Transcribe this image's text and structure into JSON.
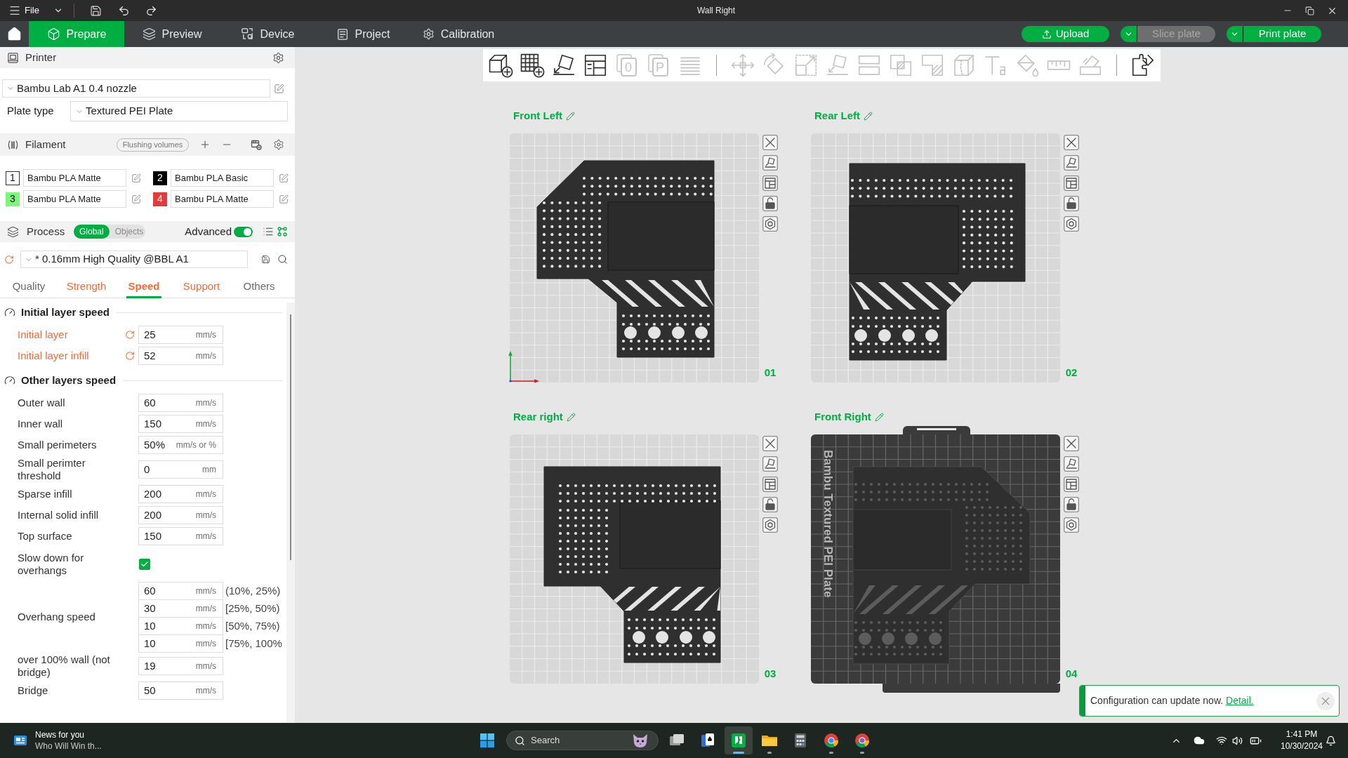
{
  "window": {
    "menu": "File",
    "title": "Wall Right"
  },
  "tabs": [
    {
      "label": "Prepare",
      "selected": true
    },
    {
      "label": "Preview",
      "selected": false
    },
    {
      "label": "Device",
      "selected": false
    },
    {
      "label": "Project",
      "selected": false
    },
    {
      "label": "Calibration",
      "selected": false
    }
  ],
  "actions": [
    {
      "kind": "upload",
      "label": "Upload",
      "disabled": false
    },
    {
      "kind": "split",
      "label": "Slice plate",
      "disabled": true
    },
    {
      "kind": "split",
      "label": "Print plate",
      "disabled": false
    }
  ],
  "printer": {
    "title": "Printer",
    "preset": "Bambu Lab A1 0.4 nozzle",
    "plate_type_label": "Plate type",
    "plate_type": "Textured PEI Plate"
  },
  "filament": {
    "title": "Filament",
    "flushing": "Flushing volumes",
    "slots": [
      {
        "number": "1",
        "name": "Bambu PLA Matte",
        "color": "#ffffff"
      },
      {
        "number": "2",
        "name": "Bambu PLA Basic",
        "color": "#000000"
      },
      {
        "number": "3",
        "name": "Bambu PLA Matte",
        "color": "#7ef57e"
      },
      {
        "number": "4",
        "name": "Bambu PLA Matte",
        "color": "#e03c3c"
      }
    ]
  },
  "process": {
    "title": "Process",
    "scope": [
      {
        "label": "Global",
        "selected": true
      },
      {
        "label": "Objects",
        "selected": false
      }
    ],
    "advanced": {
      "label": "Advanced",
      "on": true
    },
    "preset": "* 0.16mm High Quality @BBL A1",
    "tabs": [
      {
        "label": "Quality",
        "selected": false,
        "modified": false
      },
      {
        "label": "Strength",
        "selected": false,
        "modified": true
      },
      {
        "label": "Speed",
        "selected": true,
        "modified": true
      },
      {
        "label": "Support",
        "selected": false,
        "modified": true
      },
      {
        "label": "Others",
        "selected": false,
        "modified": false
      }
    ],
    "sections": [
      {
        "title": "Initial layer speed",
        "rows": [
          {
            "kind": "field",
            "label": "Initial layer",
            "modified": true,
            "value": "25",
            "unit": "mm/s"
          },
          {
            "kind": "field",
            "label": "Initial layer infill",
            "modified": true,
            "value": "52",
            "unit": "mm/s"
          }
        ]
      },
      {
        "title": "Other layers speed",
        "rows": [
          {
            "kind": "field",
            "label": "Outer wall",
            "modified": false,
            "value": "60",
            "unit": "mm/s"
          },
          {
            "kind": "field",
            "label": "Inner wall",
            "modified": false,
            "value": "150",
            "unit": "mm/s"
          },
          {
            "kind": "field",
            "label": "Small perimeters",
            "modified": false,
            "value": "50%",
            "unit": "mm/s or %"
          },
          {
            "kind": "field",
            "label": "Small perimter threshold",
            "modified": false,
            "value": "0",
            "unit": "mm"
          },
          {
            "kind": "field",
            "label": "Sparse infill",
            "modified": false,
            "value": "200",
            "unit": "mm/s"
          },
          {
            "kind": "field",
            "label": "Internal solid infill",
            "modified": false,
            "value": "200",
            "unit": "mm/s"
          },
          {
            "kind": "field",
            "label": "Top surface",
            "modified": false,
            "value": "150",
            "unit": "mm/s"
          },
          {
            "kind": "checkbox",
            "label": "Slow down for overhangs",
            "modified": false,
            "checked": true
          },
          {
            "kind": "multi",
            "label": "Overhang speed",
            "modified": false,
            "fields": [
              {
                "value": "60",
                "unit": "mm/s",
                "range": "(10%, 25%)"
              },
              {
                "value": "30",
                "unit": "mm/s",
                "range": "[25%, 50%)"
              },
              {
                "value": "10",
                "unit": "mm/s",
                "range": "[50%, 75%)"
              },
              {
                "value": "10",
                "unit": "mm/s",
                "range": "[75%, 100%"
              }
            ]
          },
          {
            "kind": "field",
            "label": "over 100% wall (not bridge)",
            "modified": false,
            "value": "19",
            "unit": "mm/s"
          },
          {
            "kind": "field",
            "label": "Bridge",
            "modified": false,
            "value": "50",
            "unit": "mm/s"
          }
        ]
      }
    ]
  },
  "toolbar": [
    [
      {
        "kind": "addpart",
        "disabled": false
      },
      {
        "kind": "addplate",
        "disabled": false
      },
      {
        "kind": "orient",
        "disabled": false
      },
      {
        "kind": "arrange",
        "disabled": false
      },
      {
        "kind": "number",
        "glyph": "0",
        "disabled": true
      },
      {
        "kind": "letter",
        "glyph": "P",
        "disabled": true
      },
      {
        "kind": "layers",
        "disabled": true
      }
    ],
    [
      {
        "kind": "move",
        "disabled": true
      },
      {
        "kind": "rotate",
        "disabled": true
      },
      {
        "kind": "scale",
        "disabled": true
      },
      {
        "kind": "layflat",
        "disabled": true
      },
      {
        "kind": "cut",
        "disabled": true
      },
      {
        "kind": "boolean",
        "disabled": true
      },
      {
        "kind": "support",
        "disabled": true
      },
      {
        "kind": "seam",
        "disabled": true
      },
      {
        "kind": "text",
        "disabled": true
      },
      {
        "kind": "paint",
        "disabled": true
      },
      {
        "kind": "measure",
        "disabled": true
      },
      {
        "kind": "assembly",
        "disabled": true
      }
    ],
    [
      {
        "kind": "explode",
        "disabled": false
      }
    ]
  ],
  "plates": [
    {
      "name": "Front Left",
      "number": "01",
      "selected": false,
      "axes": true
    },
    {
      "name": "Rear Left",
      "number": "02",
      "selected": false,
      "axes": false
    },
    {
      "name": "Rear right",
      "number": "03",
      "selected": false,
      "axes": false
    },
    {
      "name": "Front Right",
      "number": "04",
      "selected": true,
      "axes": false,
      "plate_label": "Bambu Textured PEI Plate"
    }
  ],
  "notification": {
    "message": "Configuration can update now.",
    "link": "Detail."
  },
  "taskbar": {
    "news_title": "News for you",
    "news_text": "Who Will Win th...",
    "search": {
      "placeholder": "Search"
    },
    "apps": [
      {
        "running": false,
        "active": false
      },
      {
        "running": false,
        "active": false
      },
      {
        "running": true,
        "active": true
      },
      {
        "running": true,
        "active": false
      },
      {
        "running": false,
        "active": false
      },
      {
        "running": true,
        "active": false
      },
      {
        "running": true,
        "active": false
      }
    ],
    "time": "1:41 PM",
    "date": "10/30/2024"
  }
}
